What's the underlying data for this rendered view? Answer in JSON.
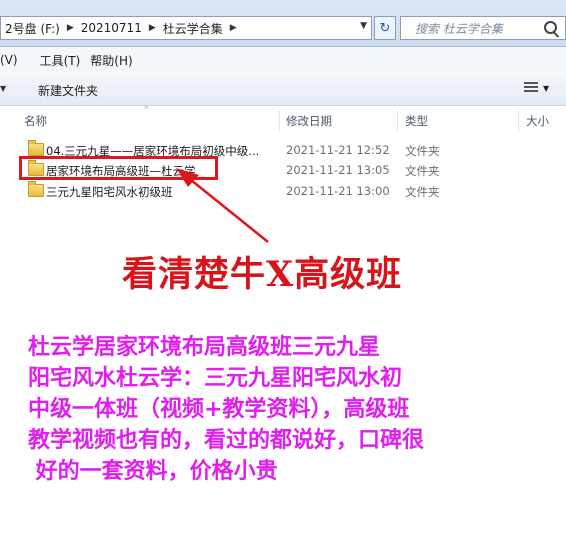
{
  "address_bar": {
    "crumbs": [
      "2号盘 (F:)",
      "20210711",
      "杜云学合集"
    ],
    "search_placeholder": "搜索 杜云学合集"
  },
  "menu": {
    "items": [
      "(V)",
      "工具(T)",
      "帮助(H)"
    ]
  },
  "toolbar": {
    "new_folder": "新建文件夹"
  },
  "columns": {
    "name": "名称",
    "date": "修改日期",
    "type": "类型",
    "size": "大小"
  },
  "files": [
    {
      "name": "04.三元九星——居家环境布局初级中级...",
      "date": "2021-11-21 12:52",
      "type": "文件夹"
    },
    {
      "name": "居家环境布局高级班—杜云学",
      "date": "2021-11-21 13:05",
      "type": "文件夹"
    },
    {
      "name": "三元九星阳宅风水初级班",
      "date": "2021-11-21 13:00",
      "type": "文件夹"
    }
  ],
  "annotation": {
    "title": "看清楚牛X高级班",
    "lines": [
      "杜云学居家环境布局高级班三元九星",
      "阳宅风水杜云学：三元九星阳宅风水初",
      "中级一体班（视频+教学资料），高级班",
      "教学视频也有的，看过的都说好，口碑很",
      " 好的一套资料，价格小贵"
    ],
    "title_color": "#d8141b",
    "text_color": "#e11df0",
    "highlight_color": "#e0161d"
  }
}
